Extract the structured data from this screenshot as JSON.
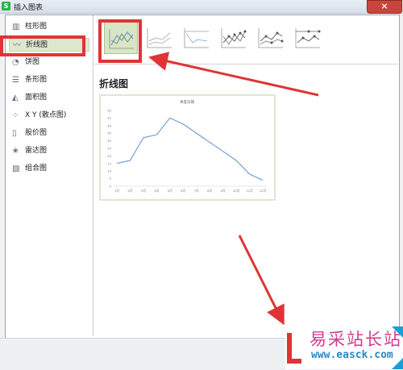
{
  "window": {
    "title": "插入图表",
    "close_glyph": "×"
  },
  "sidebar": {
    "items": [
      {
        "label": "柱形图",
        "icon": "column-chart-icon",
        "glyph": "▥"
      },
      {
        "label": "折线图",
        "icon": "line-chart-icon",
        "glyph": "〰",
        "selected": true
      },
      {
        "label": "饼图",
        "icon": "pie-chart-icon",
        "glyph": "◔"
      },
      {
        "label": "条形图",
        "icon": "bar-chart-icon",
        "glyph": "☰"
      },
      {
        "label": "面积图",
        "icon": "area-chart-icon",
        "glyph": "◭"
      },
      {
        "label": "X Y (散点图)",
        "icon": "scatter-chart-icon",
        "glyph": "⁘"
      },
      {
        "label": "股价图",
        "icon": "stock-chart-icon",
        "glyph": "▯"
      },
      {
        "label": "雷达图",
        "icon": "radar-chart-icon",
        "glyph": "✬"
      },
      {
        "label": "组合图",
        "icon": "combo-chart-icon",
        "glyph": "▧"
      }
    ]
  },
  "subtypes": {
    "selected_index": 0,
    "names": [
      "line",
      "stacked-line",
      "percent-stacked-line",
      "line-with-markers",
      "stacked-line-with-markers",
      "percent-stacked-line-with-markers"
    ]
  },
  "section_title": "折线图",
  "chart_data": {
    "type": "line",
    "title": "季度日期",
    "categories": [
      "1月",
      "2月",
      "3月",
      "4月",
      "5月",
      "6月",
      "7月",
      "8月",
      "9月",
      "10月",
      "11月",
      "12月"
    ],
    "series": [
      {
        "values": [
          15,
          17,
          32,
          34,
          45,
          41,
          35,
          29,
          23,
          17,
          8,
          4
        ]
      }
    ],
    "ylim": [
      0,
      50
    ],
    "yticks": [
      "0",
      "5",
      "10",
      "15",
      "20",
      "25",
      "30",
      "35",
      "40",
      "45",
      "50"
    ],
    "grid": false,
    "line_color": "#7ea6d8"
  },
  "watermark": {
    "text_cn": "易采站长站",
    "url": "www.easck.com"
  },
  "colors": {
    "highlight_red": "#e03434",
    "selected_green": "#d8e6c6"
  }
}
